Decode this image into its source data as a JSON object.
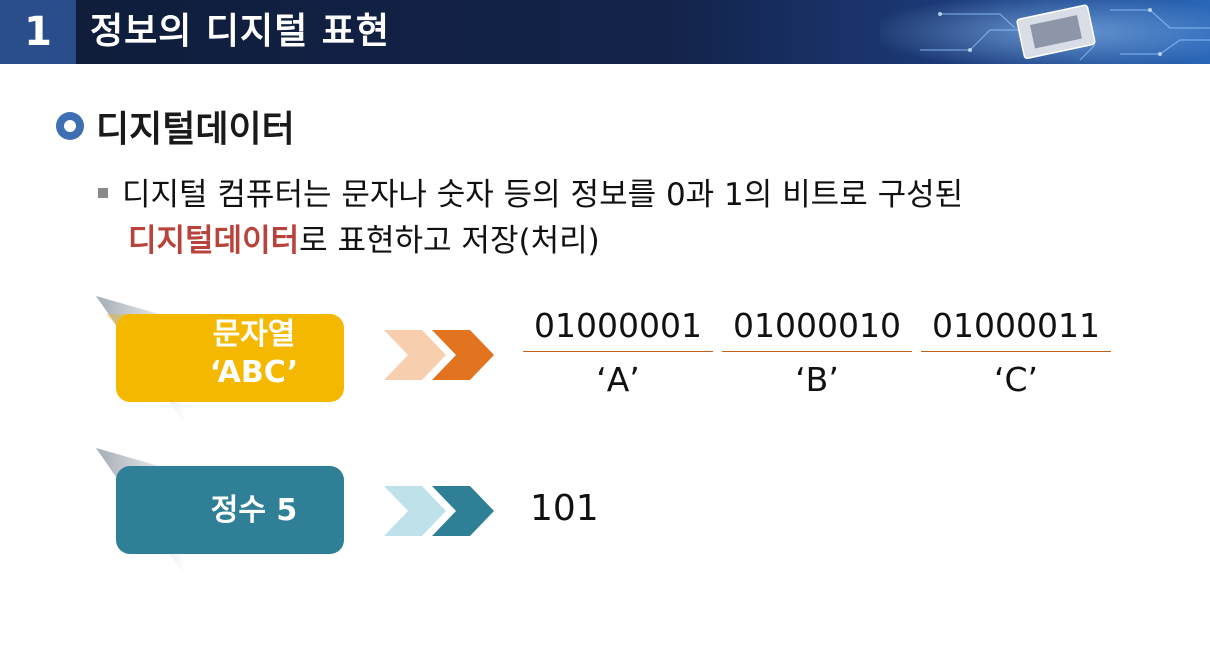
{
  "header": {
    "number": "1",
    "title": "정보의 디지털 표현"
  },
  "section": {
    "heading": "디지털데이터"
  },
  "paragraph": {
    "line1": "디지털 컴퓨터는 문자나 숫자 등의 정보를 0과 1의 비트로 구성된",
    "line2_emphasis": "디지털데이터",
    "line2_rest": "로 표현하고 저장(처리)"
  },
  "rows": [
    {
      "label_line1": "문자열",
      "label_line2": "‘ABC’",
      "color": "#f5b800",
      "arrow_light": "#f8cfae",
      "arrow_dark": "#e2731f",
      "values": [
        {
          "bits": "01000001",
          "char": "‘A’"
        },
        {
          "bits": "01000010",
          "char": "‘B’"
        },
        {
          "bits": "01000011",
          "char": "‘C’"
        }
      ]
    },
    {
      "label_line1": "정수 5",
      "color": "#2f7f96",
      "arrow_light": "#bfe1ea",
      "arrow_dark": "#2f7f96",
      "value": "101"
    }
  ]
}
